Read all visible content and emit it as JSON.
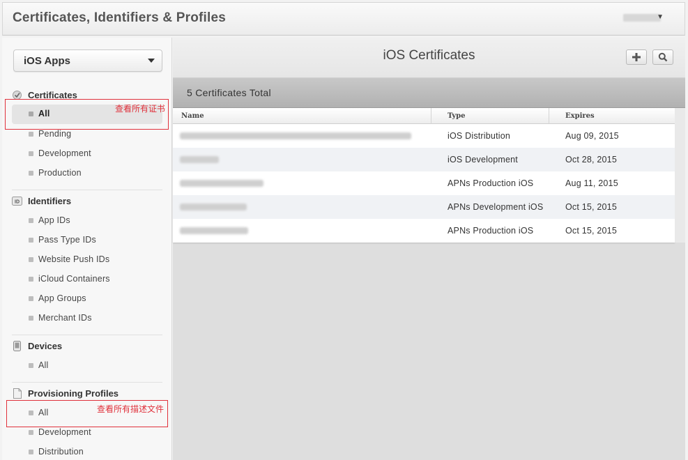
{
  "header": {
    "title": "Certificates, Identifiers & Profiles"
  },
  "sidebar": {
    "platform_select": "iOS Apps",
    "sections": {
      "certificates": {
        "label": "Certificates",
        "items": [
          "All",
          "Pending",
          "Development",
          "Production"
        ]
      },
      "identifiers": {
        "label": "Identifiers",
        "icon_text": "ID",
        "items": [
          "App IDs",
          "Pass Type IDs",
          "Website Push IDs",
          "iCloud Containers",
          "App Groups",
          "Merchant IDs"
        ]
      },
      "devices": {
        "label": "Devices",
        "items": [
          "All"
        ]
      },
      "profiles": {
        "label": "Provisioning Profiles",
        "items": [
          "All",
          "Development",
          "Distribution"
        ]
      }
    }
  },
  "annotations": {
    "certificates_note": "查看所有证书",
    "profiles_note": "查看所有描述文件",
    "color": "#e0313b"
  },
  "main": {
    "title": "iOS Certificates",
    "count_text": "5 Certificates Total",
    "columns": [
      "Name",
      "Type",
      "Expires"
    ],
    "rows": [
      {
        "type": "iOS Distribution",
        "expires": "Aug 09, 2015"
      },
      {
        "type": "iOS Development",
        "expires": "Oct 28, 2015"
      },
      {
        "type": "APNs Production iOS",
        "expires": "Aug 11, 2015"
      },
      {
        "type": "APNs Development iOS",
        "expires": "Oct 15, 2015"
      },
      {
        "type": "APNs Production iOS",
        "expires": "Oct 15, 2015"
      }
    ],
    "icons": {
      "add": "plus-icon",
      "search": "search-icon"
    }
  }
}
